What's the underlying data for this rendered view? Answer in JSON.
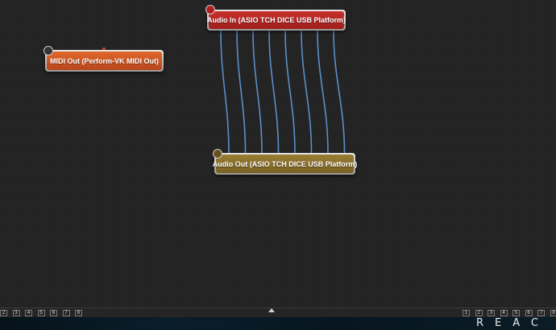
{
  "nodes": {
    "midi_out": {
      "label": "MIDI Out (Perform-VK MIDI Out)",
      "color": "#c8521f"
    },
    "audio_in": {
      "label": "Audio In (ASIO TCH DICE USB Platform)",
      "color": "#b3282a"
    },
    "audio_out": {
      "label": "Audio Out (ASIO TCH DICE USB Platform)",
      "color": "#8a6c2a"
    }
  },
  "connections": {
    "count": 8,
    "color": "#5b8fc8"
  },
  "left_pages": [
    "2",
    "3",
    "4",
    "5",
    "6",
    "7",
    "8"
  ],
  "right_pages": [
    "1",
    "2",
    "3",
    "4",
    "5",
    "6",
    "7",
    "8"
  ],
  "brand": "REAC",
  "icons": [
    "midi-node-icon",
    "audio-in-node-icon",
    "audio-out-node-icon",
    "collapse-arrow-icon"
  ]
}
